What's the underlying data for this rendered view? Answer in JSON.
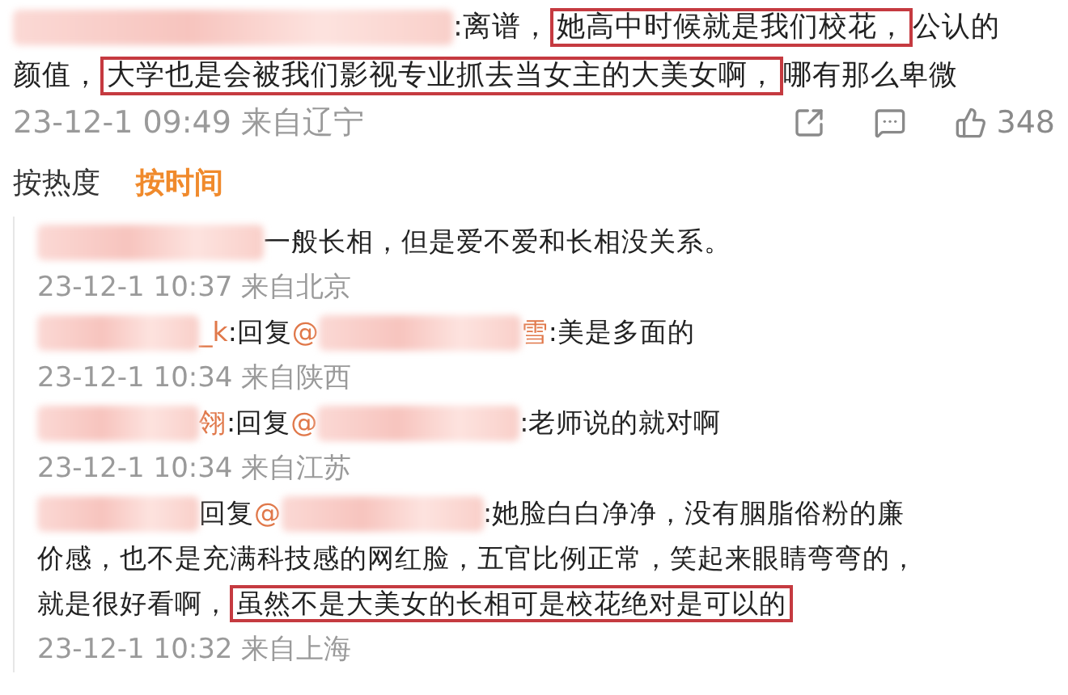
{
  "comment": {
    "segments": [
      {
        "kind": "blur"
      },
      {
        "kind": "text",
        "text": ":离谱，"
      },
      {
        "kind": "highlight",
        "text": "她高中时候就是我们校花，"
      },
      {
        "kind": "text",
        "text": "公认的"
      },
      {
        "kind": "text",
        "text": "颜值，"
      },
      {
        "kind": "highlight",
        "text": "大学也是会被我们影视专业抓去当女主的大美女啊，"
      },
      {
        "kind": "text",
        "text": "哪有那么卑微"
      }
    ],
    "time": "23-12-1 09:49 来自辽宁",
    "likes": "348"
  },
  "sort_tabs": [
    {
      "label": "按热度",
      "selected": false
    },
    {
      "label": "按时间",
      "selected": true
    }
  ],
  "replies": [
    {
      "segments": [
        {
          "kind": "blur"
        },
        {
          "kind": "text",
          "text": "一般长相，但是爱不爱和长相没关系。"
        }
      ],
      "time": "23-12-1 10:37 来自北京"
    },
    {
      "segments": [
        {
          "kind": "blur"
        },
        {
          "kind": "mention",
          "text": "_k"
        },
        {
          "kind": "text",
          "text": ":回复"
        },
        {
          "kind": "mention",
          "text": "@"
        },
        {
          "kind": "blur"
        },
        {
          "kind": "mention",
          "text": "雪"
        },
        {
          "kind": "text",
          "text": ":美是多面的"
        }
      ],
      "time": "23-12-1 10:34 来自陕西"
    },
    {
      "segments": [
        {
          "kind": "blur"
        },
        {
          "kind": "mention",
          "text": "翎"
        },
        {
          "kind": "text",
          "text": ":回复"
        },
        {
          "kind": "mention",
          "text": "@"
        },
        {
          "kind": "blur"
        },
        {
          "kind": "text",
          "text": ":老师说的就对啊"
        }
      ],
      "time": "23-12-1 10:34 来自江苏"
    },
    {
      "segments": [
        {
          "kind": "blur"
        },
        {
          "kind": "text",
          "text": "回复"
        },
        {
          "kind": "mention",
          "text": "@"
        },
        {
          "kind": "blur"
        },
        {
          "kind": "text",
          "text": ":她脸白白净净，没有胭脂俗粉的廉"
        },
        {
          "kind": "text",
          "text": "价感，也不是充满科技感的网红脸，五官比例正常，笑起来眼睛弯弯的，"
        },
        {
          "kind": "text",
          "text": "就是很好看啊，"
        },
        {
          "kind": "highlight",
          "text": "虽然不是大美女的长相可是校花绝对是可以的"
        }
      ],
      "time": "23-12-1 10:32 来自上海"
    }
  ]
}
